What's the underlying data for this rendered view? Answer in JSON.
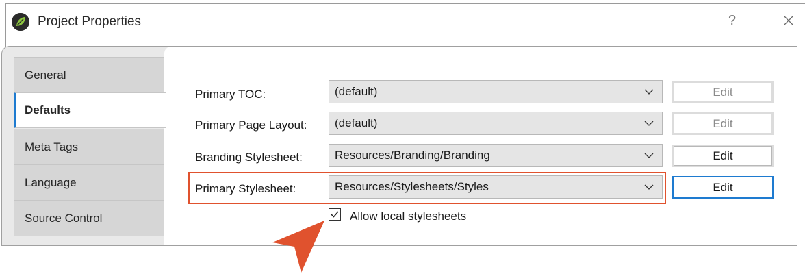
{
  "window": {
    "title": "Project Properties",
    "help_label": "?"
  },
  "icons": {
    "app": "flare-leaf-icon",
    "close": "close-icon",
    "chevron": "chevron-down-icon",
    "check": "checkmark-icon",
    "callout": "pointer-arrow-icon"
  },
  "colors": {
    "accent": "#1e7bd0",
    "highlight": "#e0522e",
    "app_icon_leaf": "#8dc63f"
  },
  "tabs": [
    {
      "label": "General",
      "active": false
    },
    {
      "label": "Defaults",
      "active": true
    },
    {
      "label": "Meta Tags",
      "active": false
    },
    {
      "label": "Language",
      "active": false
    },
    {
      "label": "Source Control",
      "active": false
    }
  ],
  "rows": [
    {
      "label": "Primary TOC:",
      "value": "(default)",
      "edit_label": "Edit",
      "edit_state": "disabled"
    },
    {
      "label": "Primary Page Layout:",
      "value": "(default)",
      "edit_label": "Edit",
      "edit_state": "disabled"
    },
    {
      "label": "Branding Stylesheet:",
      "value": "Resources/Branding/Branding",
      "edit_label": "Edit",
      "edit_state": "enabled"
    },
    {
      "label": "Primary Stylesheet:",
      "value": "Resources/Stylesheets/Styles",
      "edit_label": "Edit",
      "edit_state": "focused"
    }
  ],
  "allow_local": {
    "label": "Allow local stylesheets",
    "checked": true
  }
}
